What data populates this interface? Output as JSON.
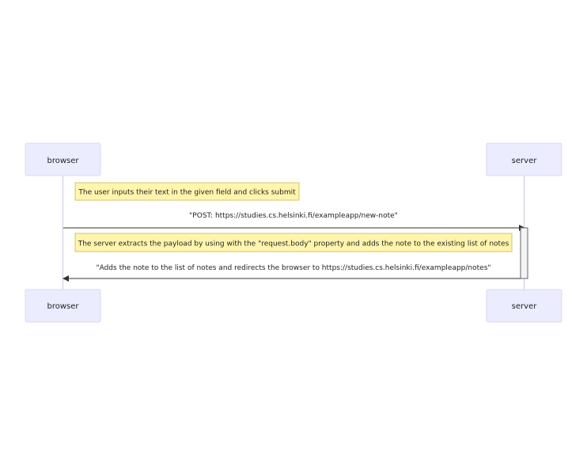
{
  "actors": {
    "browser": "browser",
    "server": "server"
  },
  "notes": {
    "user_input": "The user inputs their text in the given field and clicks submit",
    "server_extract": "The server extracts the payload by using with the \"request.body\" property and adds the note to the existing list of notes"
  },
  "messages": {
    "post": "\"POST: https://studies.cs.helsinki.fi/exampleapp/new-note\"",
    "redirect": "\"Adds the note to the list of notes and redirects the browser to https://studies.cs.helsinki.fi/exampleapp/notes\""
  },
  "colors": {
    "actor_fill": "#ececff",
    "note_fill": "#fff5ad",
    "line": "#333333"
  }
}
